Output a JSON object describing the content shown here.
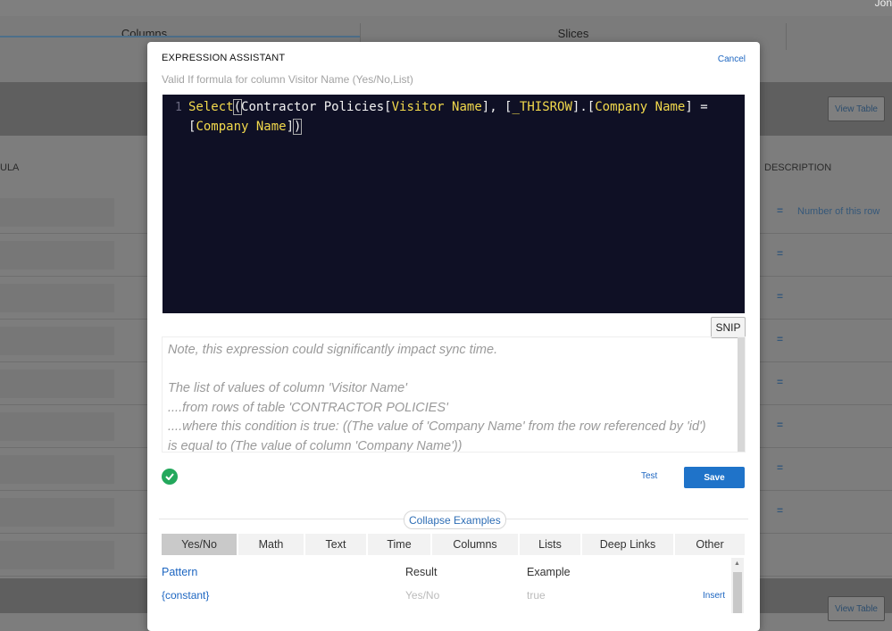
{
  "background": {
    "user_fragment": "Jon",
    "tabs": [
      "Columns",
      "Slices"
    ],
    "view_table_label": "View Table",
    "col_formula_fragment": "ULA",
    "col_description": "DESCRIPTION",
    "row_eq_symbol": "=",
    "row_description": "Number of this row"
  },
  "modal": {
    "title": "EXPRESSION ASSISTANT",
    "cancel_label": "Cancel",
    "subtitle": "Valid If formula for column Visitor Name (Yes/No,List)",
    "editor": {
      "line_number": "1",
      "line1": {
        "keyword": "Select",
        "b1": "(",
        "t1": "Contractor Policies",
        "b2": "[",
        "col1": "Visitor Name",
        "t2": "], [",
        "kw2": "_THISROW",
        "t3": "].[",
        "col2": "Company Name",
        "t4": "] ="
      },
      "line2": {
        "b3": "[",
        "col3": "Company Name",
        "b4": "]",
        "b5": ")"
      }
    },
    "snip_label": "SNIP",
    "note_lines": [
      "Note, this expression could significantly impact sync time.",
      "",
      "The list of values of column 'Visitor Name'",
      "....from rows of table 'CONTRACTOR POLICIES'",
      "....where this condition is true: ((The value of 'Company Name' from the row referenced by 'id')",
      "is equal to (The value of column 'Company Name'))"
    ],
    "test_label": "Test",
    "save_label": "Save",
    "collapse_label": "Collapse Examples",
    "example_tabs": [
      "Yes/No",
      "Math",
      "Text",
      "Time",
      "Columns",
      "Lists",
      "Deep Links",
      "Other"
    ],
    "example_headers": {
      "pattern": "Pattern",
      "result": "Result",
      "example": "Example"
    },
    "example_rows": [
      {
        "pattern": "{constant}",
        "result": "Yes/No",
        "example": "true",
        "action": "Insert"
      }
    ]
  },
  "colors": {
    "accent": "#1f73c9",
    "editor_bg": "#0f1025",
    "keyword": "#f2d94c",
    "success": "#23a85c"
  }
}
